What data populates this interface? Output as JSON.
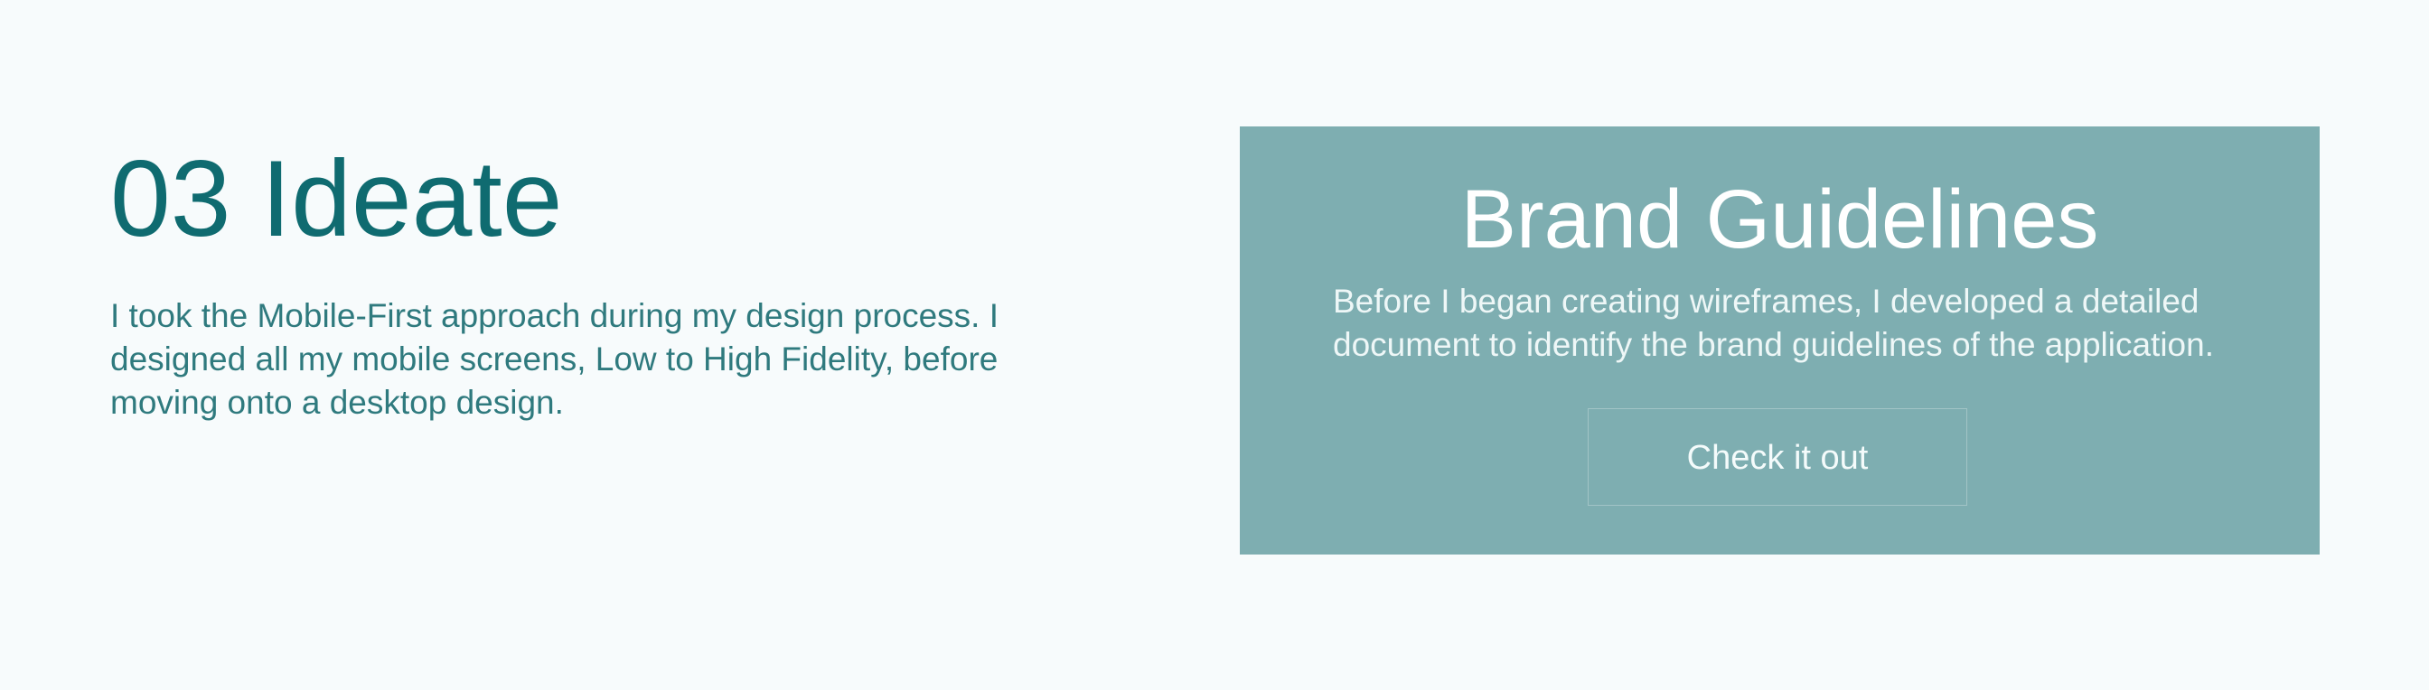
{
  "ideate": {
    "heading": "03 Ideate",
    "paragraph": "I took the Mobile-First approach during my design process. I designed all my mobile screens, Low to High Fidelity, before moving onto a desktop design."
  },
  "brand_card": {
    "title": "Brand Guidelines",
    "description": "Before I began creating wireframes, I developed a detailed document to identify the brand guidelines of the application.",
    "button_label": "Check it out"
  },
  "colors": {
    "page_background": "#f7fbfc",
    "heading_teal": "#0f6b70",
    "card_background": "#7eaeb1"
  }
}
